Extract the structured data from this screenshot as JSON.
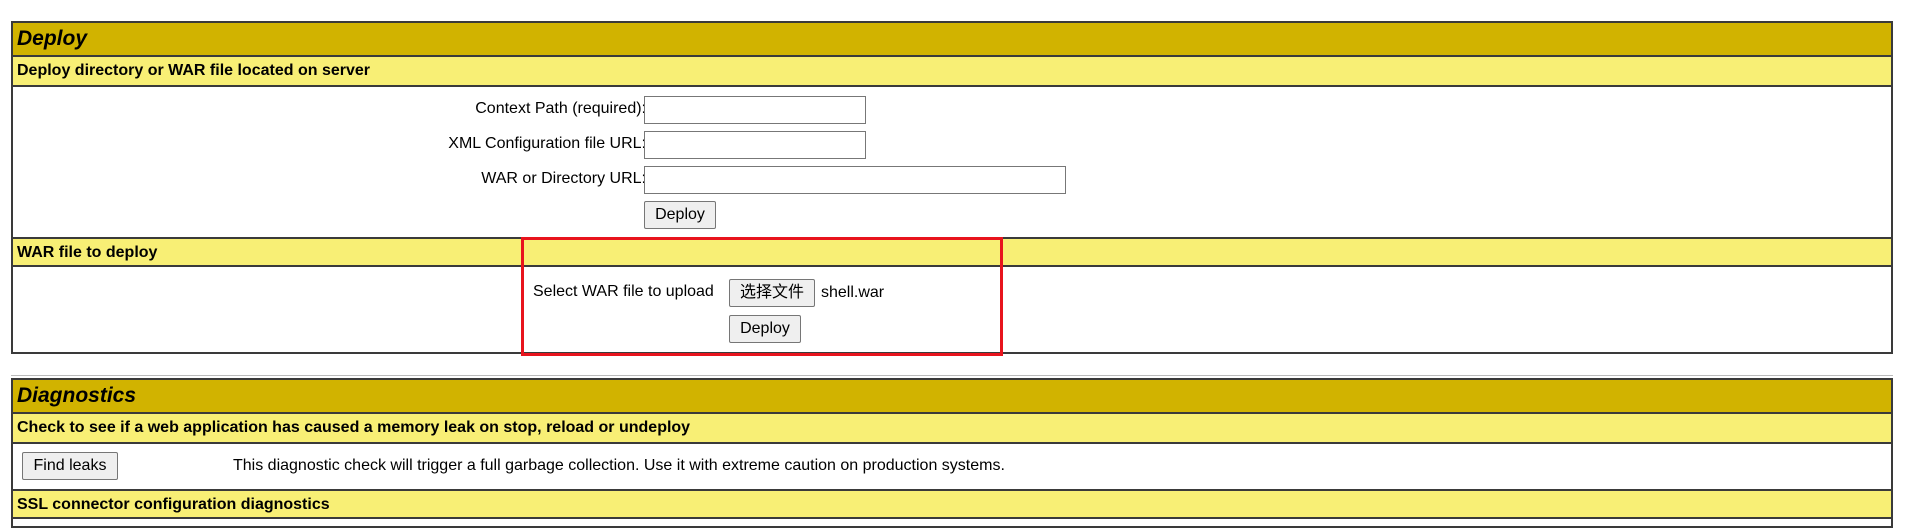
{
  "deploy": {
    "title": "Deploy",
    "server_section": {
      "heading": "Deploy directory or WAR file located on server",
      "context_path_label": "Context Path (required):",
      "context_path_value": "",
      "xml_config_label": "XML Configuration file URL:",
      "xml_config_value": "",
      "war_dir_label": "WAR or Directory URL:",
      "war_dir_value": "",
      "deploy_button": "Deploy"
    },
    "upload_section": {
      "heading": "WAR file to deploy",
      "select_label": "Select WAR file to upload",
      "choose_file_button": "选择文件",
      "selected_file": "shell.war",
      "deploy_button": "Deploy"
    }
  },
  "diagnostics": {
    "title": "Diagnostics",
    "memory_leak": {
      "heading": "Check to see if a web application has caused a memory leak on stop, reload or undeploy",
      "find_leaks_button": "Find leaks",
      "description": "This diagnostic check will trigger a full garbage collection. Use it with extreme caution on production systems."
    },
    "ssl": {
      "heading": "SSL connector configuration diagnostics"
    }
  },
  "colors": {
    "header_bg": "#d1b300",
    "subheader_bg": "#f8ef75",
    "highlight_border": "#e8141d"
  }
}
